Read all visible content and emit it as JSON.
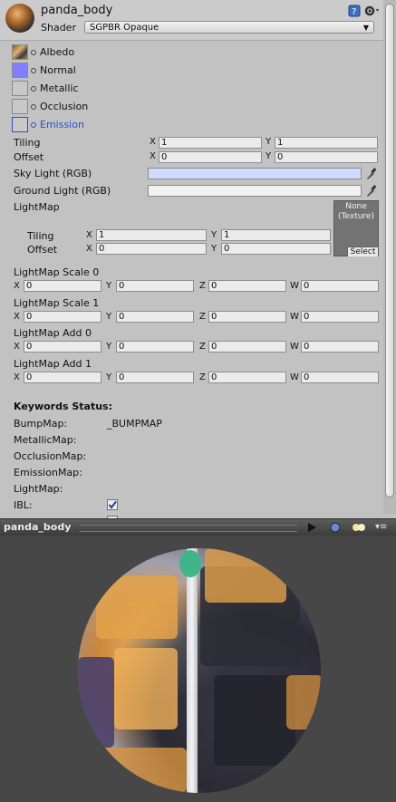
{
  "header": {
    "title": "panda_body",
    "shader_label": "Shader",
    "shader_value": "SGPBR Opaque"
  },
  "textures": [
    {
      "label": "Albedo",
      "name": "albedo"
    },
    {
      "label": "Normal",
      "name": "normal"
    },
    {
      "label": "Metallic",
      "name": "metallic"
    },
    {
      "label": "Occlusion",
      "name": "occlusion"
    },
    {
      "label": "Emission",
      "name": "emission"
    }
  ],
  "tiling": {
    "label": "Tiling",
    "x": "1",
    "y": "1"
  },
  "offset": {
    "label": "Offset",
    "x": "0",
    "y": "0"
  },
  "sky_light": {
    "label": "Sky Light (RGB)",
    "color": "#cfdcff"
  },
  "ground_light": {
    "label": "Ground Light (RGB)",
    "color": "#f2f2f2"
  },
  "lightmap": {
    "label": "LightMap",
    "slot_text": "None\n(Texture)",
    "select_label": "Select",
    "tiling": {
      "label": "Tiling",
      "x": "1",
      "y": "1"
    },
    "offset": {
      "label": "Offset",
      "x": "0",
      "y": "0"
    }
  },
  "axes": {
    "x": "X",
    "y": "Y",
    "z": "Z",
    "w": "W"
  },
  "vectors": [
    {
      "label": "LightMap Scale 0",
      "x": "0",
      "y": "0",
      "z": "0",
      "w": "0"
    },
    {
      "label": "LightMap Scale 1",
      "x": "0",
      "y": "0",
      "z": "0",
      "w": "0"
    },
    {
      "label": "LightMap Add 0",
      "x": "0",
      "y": "0",
      "z": "0",
      "w": "0"
    },
    {
      "label": "LightMap Add 1",
      "x": "0",
      "y": "0",
      "z": "0",
      "w": "0"
    }
  ],
  "keywords": {
    "title": "Keywords Status:",
    "rows": [
      {
        "label": "BumpMap:",
        "value": "_BUMPMAP"
      },
      {
        "label": "MetallicMap:",
        "value": ""
      },
      {
        "label": "OcclusionMap:",
        "value": ""
      },
      {
        "label": "EmissionMap:",
        "value": ""
      },
      {
        "label": "LightMap:",
        "value": ""
      }
    ],
    "ibl_label": "IBL:",
    "ibl_checked": true
  },
  "preview": {
    "title": "panda_body"
  },
  "colors": {
    "emission_label": "#2b4fd4",
    "normal_swatch": "#7f7fff",
    "panel_bg": "#c2c2c2",
    "preview_bg": "#474747"
  }
}
